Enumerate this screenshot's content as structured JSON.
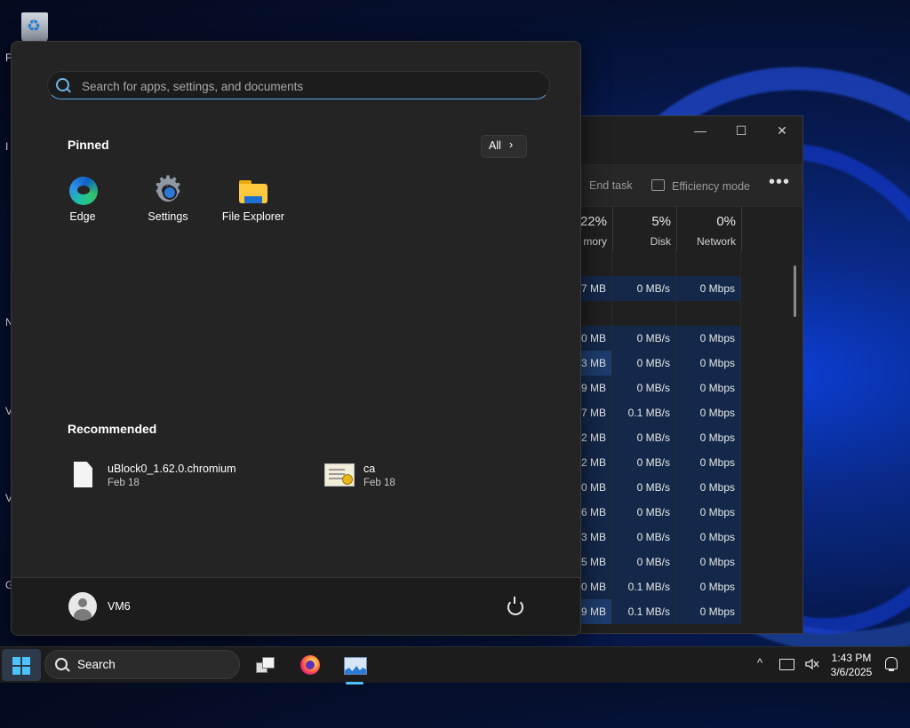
{
  "desktop": {
    "side_letters": [
      "F",
      "I",
      "N",
      "V",
      "V",
      "G"
    ]
  },
  "task_manager": {
    "toolbar": {
      "end_task": "End task",
      "efficiency_mode": "Efficiency mode",
      "more": "•••"
    },
    "columns": [
      {
        "pct": "22%",
        "label": "mory"
      },
      {
        "pct": "5%",
        "label": "Disk"
      },
      {
        "pct": "0%",
        "label": "Network"
      }
    ],
    "rows": [
      [
        "",
        "",
        ""
      ],
      [
        "7 MB",
        "0 MB/s",
        "0 Mbps"
      ],
      [
        "",
        "",
        ""
      ],
      [
        "0 MB",
        "0 MB/s",
        "0 Mbps"
      ],
      [
        "3 MB",
        "0 MB/s",
        "0 Mbps"
      ],
      [
        "9 MB",
        "0 MB/s",
        "0 Mbps"
      ],
      [
        "7 MB",
        "0.1 MB/s",
        "0 Mbps"
      ],
      [
        "2 MB",
        "0 MB/s",
        "0 Mbps"
      ],
      [
        "2 MB",
        "0 MB/s",
        "0 Mbps"
      ],
      [
        "0 MB",
        "0 MB/s",
        "0 Mbps"
      ],
      [
        "6 MB",
        "0 MB/s",
        "0 Mbps"
      ],
      [
        "3 MB",
        "0 MB/s",
        "0 Mbps"
      ],
      [
        "5 MB",
        "0 MB/s",
        "0 Mbps"
      ],
      [
        "0 MB",
        "0.1 MB/s",
        "0 Mbps"
      ],
      [
        "9 MB",
        "0.1 MB/s",
        "0 Mbps"
      ]
    ],
    "controls": {
      "minimize": "—",
      "maximize": "☐",
      "close": "✕"
    }
  },
  "start_menu": {
    "search_placeholder": "Search for apps, settings, and documents",
    "pinned_title": "Pinned",
    "all_label": "All",
    "all_chevron": "›",
    "pinned_apps": [
      {
        "label": "Edge",
        "icon": "edge-icon"
      },
      {
        "label": "Settings",
        "icon": "settings-gear-icon"
      },
      {
        "label": "File Explorer",
        "icon": "folder-icon"
      }
    ],
    "recommended_title": "Recommended",
    "recommended": [
      {
        "name": "uBlock0_1.62.0.chromium",
        "date": "Feb 18",
        "icon": "file-icon"
      },
      {
        "name": "ca",
        "date": "Feb 18",
        "icon": "certificate-icon"
      }
    ],
    "user_name": "VM6"
  },
  "taskbar": {
    "search_label": "Search",
    "tray": {
      "chevron": "^",
      "time": "1:43 PM",
      "date": "3/6/2025"
    },
    "accent": "#4cc2ff"
  }
}
